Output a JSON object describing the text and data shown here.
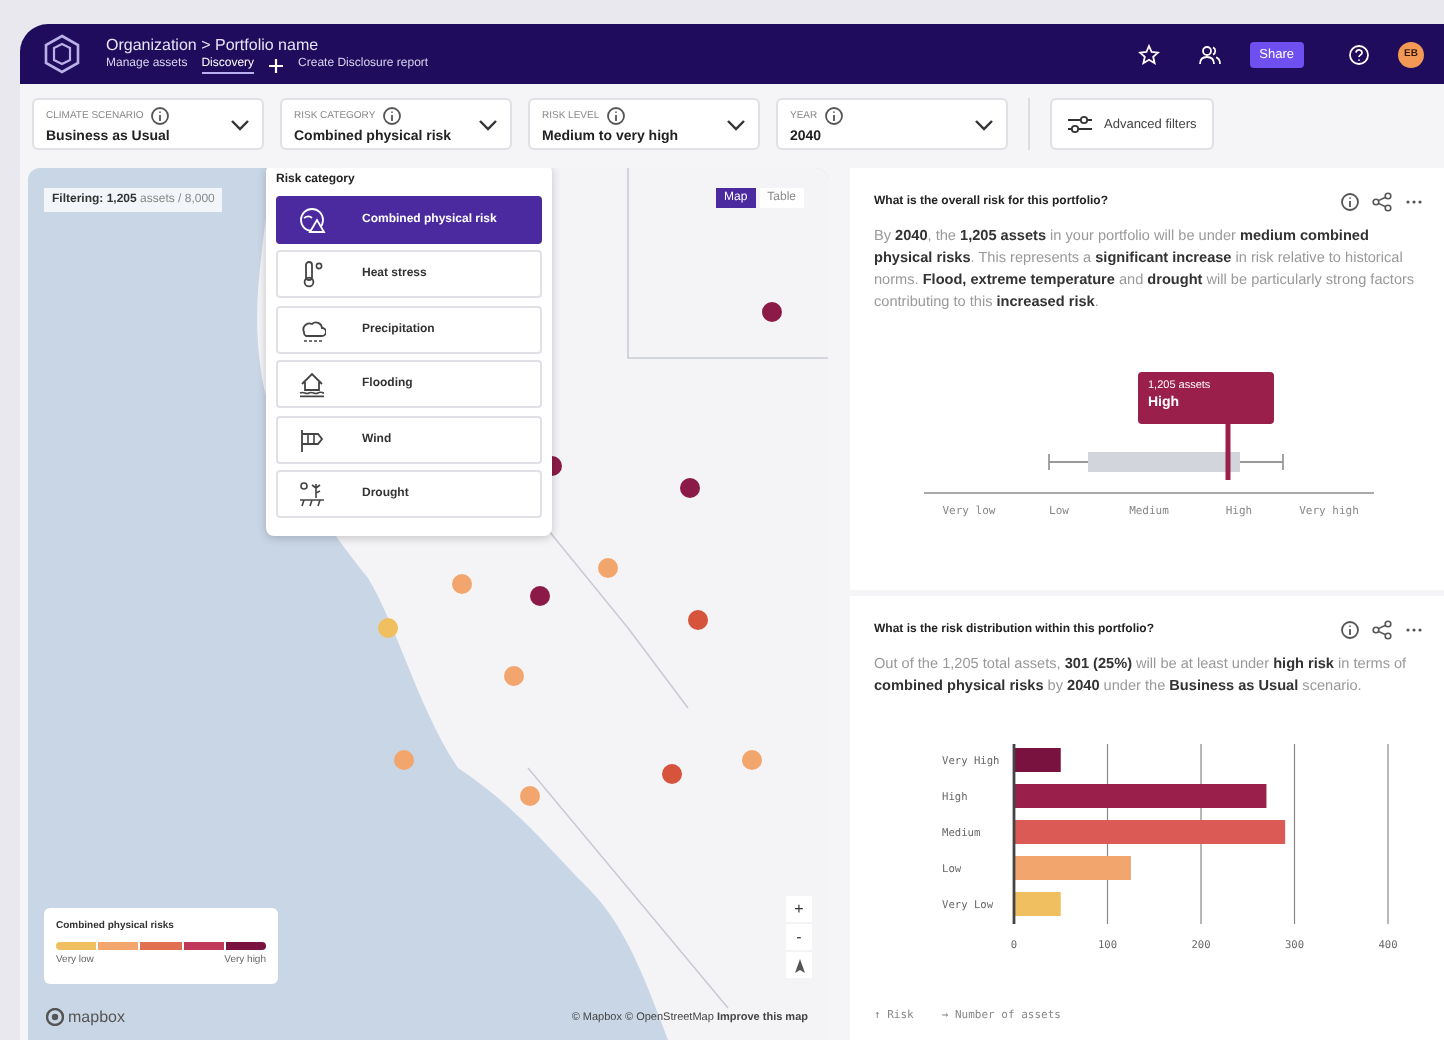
{
  "header": {
    "title": "Organization > Portfolio name",
    "nav_tabs": [
      {
        "label": "Manage assets",
        "selected": false
      },
      {
        "label": "Discovery",
        "selected": true
      },
      {
        "label": "Create Disclosure report",
        "selected": false
      }
    ],
    "share_button": "Share",
    "avatar": "EB"
  },
  "filters": [
    {
      "label": "CLIMATE SCENARIO",
      "value": "Business as Usual"
    },
    {
      "label": "RISK CATEGORY",
      "value": "Combined physical risk"
    },
    {
      "label": "RISK LEVEL",
      "value": "Medium to very high"
    },
    {
      "label": "YEAR",
      "value": "2040"
    }
  ],
  "advanced_filters": "Advanced filters",
  "map": {
    "filtering": "**Filtering: 1,205** assets / 8,000",
    "view_toggle": [
      {
        "label": "Map",
        "selected": true
      },
      {
        "label": "Table",
        "selected": false
      }
    ],
    "markers": [
      {
        "color": "#8c1a48"
      },
      {
        "color": "#8c1a48"
      },
      {
        "color": "#8c1a48"
      },
      {
        "color": "#f2a66e"
      },
      {
        "color": "#f2a66e"
      },
      {
        "color": "#8c1a48"
      },
      {
        "color": "#d6533c"
      },
      {
        "color": "#f0c060"
      },
      {
        "color": "#f2a66e"
      },
      {
        "color": "#d6533c"
      },
      {
        "color": "#f2a66e"
      },
      {
        "color": "#f2a66e"
      },
      {
        "color": "#f2a66e"
      }
    ],
    "legend": {
      "title": "Combined physical risks",
      "low_label": "Very low",
      "high_label": "Very high"
    },
    "zoom_controls": [
      "+",
      "-"
    ],
    "logo": "mapbox",
    "attribution": "© Mapbox © OpenStreetMap **Improve this map**"
  },
  "risk_category_menu": {
    "title": "Risk category",
    "items": [
      {
        "label": "Combined physical risk",
        "kind": "combined",
        "selected": true
      },
      {
        "label": "Heat stress",
        "kind": "heat",
        "selected": false
      },
      {
        "label": "Precipitation",
        "kind": "precipitation",
        "selected": false
      },
      {
        "label": "Flooding",
        "kind": "flooding",
        "selected": false
      },
      {
        "label": "Wind",
        "kind": "wind",
        "selected": false
      },
      {
        "label": "Drought",
        "kind": "drought",
        "selected": false
      }
    ]
  },
  "overall_risk": {
    "title": "What is the overall risk for this portfolio?",
    "text": "By **2040**, the **1,205 assets** in your portfolio will be under **medium combined physical risks**. This represents a **significant increase** in risk relative to historical norms. **Flood, extreme temperature** and **drought** will be particularly strong factors contributing to this **increased risk**.",
    "tooltip": {
      "caption": "1,205 assets",
      "level": "High"
    },
    "scale_labels": [
      "Very low",
      "Low",
      "Medium",
      "High",
      "Very high"
    ]
  },
  "distribution": {
    "title": "What is the risk distribution within this portfolio?",
    "text": "Out of the 1,205 total assets, **301 (25%)** will be at least under **high risk** in terms of **combined physical risks** by **2040** under the **Business as Usual** scenario.",
    "chart_data": {
      "type": "bar",
      "orientation": "horizontal",
      "categories": [
        "Very High",
        "High",
        "Medium",
        "Low",
        "Very Low"
      ],
      "series": [
        {
          "values": [
            50,
            270,
            290,
            125,
            50
          ]
        }
      ],
      "xlim": [
        0,
        400
      ],
      "xticks": [
        0,
        100,
        200,
        300,
        400
      ],
      "grid": true,
      "ylabel": "↑ Risk",
      "xlabel": "→ Number of assets"
    }
  }
}
